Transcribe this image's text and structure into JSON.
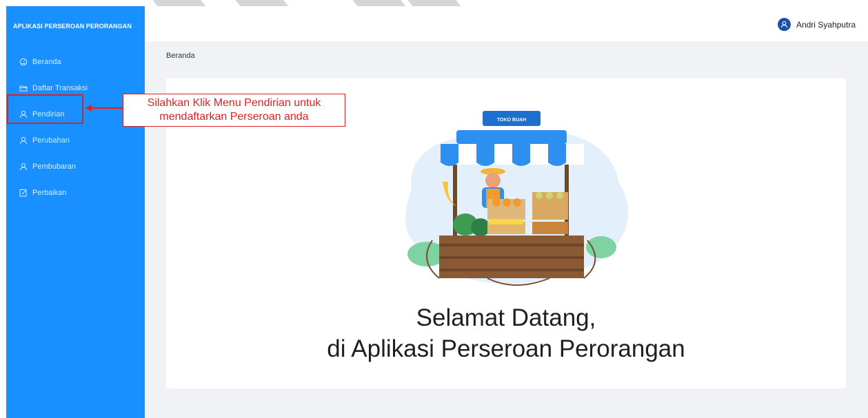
{
  "sidebar": {
    "brand": "APLIKASI PERSEROAN PERORANGAN",
    "items": [
      {
        "label": "Beranda",
        "icon": "dashboard-icon"
      },
      {
        "label": "Daftar Transaksi",
        "icon": "folder-icon"
      },
      {
        "label": "Pendirian",
        "icon": "user-icon"
      },
      {
        "label": "Perubahan",
        "icon": "user-icon"
      },
      {
        "label": "Pembubaran",
        "icon": "user-icon"
      },
      {
        "label": "Perbaikan",
        "icon": "edit-icon"
      }
    ]
  },
  "header": {
    "user_name": "Andri Syahputra"
  },
  "annotation": {
    "line1": "Silahkan Klik Menu Pendirian untuk",
    "line2": "mendaftarkan Perseroan anda"
  },
  "breadcrumb": "Beranda",
  "illustration": {
    "sign": "TOKO BUAH"
  },
  "welcome": {
    "line1": "Selamat Datang,",
    "line2": "di Aplikasi Perseroan Perorangan"
  },
  "colors": {
    "sidebar": "#1890ff",
    "annotation": "#e02020",
    "avatar": "#1d4ea8",
    "content_bg": "#f0f2f5"
  }
}
